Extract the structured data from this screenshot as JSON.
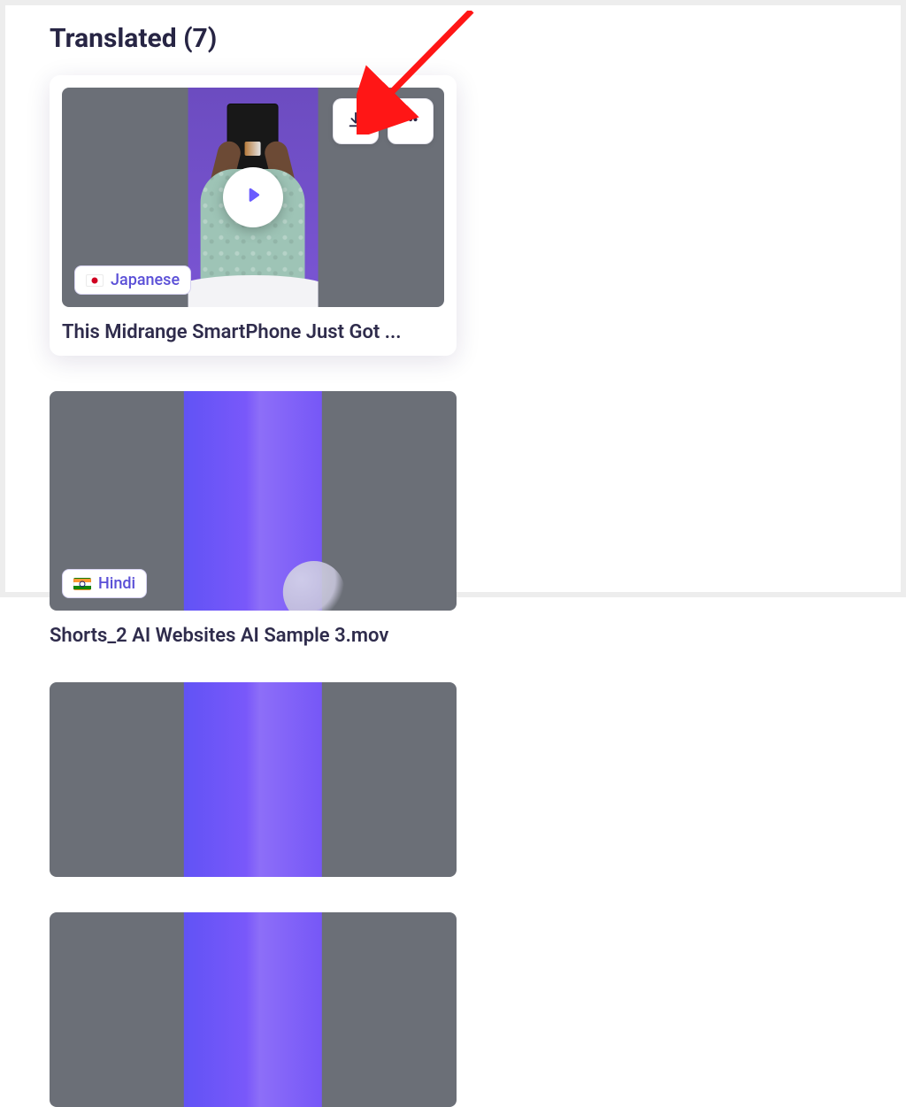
{
  "section": {
    "heading": "Translated (7)"
  },
  "cards": [
    {
      "title": "This Midrange SmartPhone Just Got ...",
      "language": "Japanese",
      "flag": "jp",
      "active": true,
      "thumbKind": "person"
    },
    {
      "title": "Shorts_2 AI Websites AI Sample 3.mov",
      "language": "Hindi",
      "flag": "in",
      "active": false,
      "thumbKind": "gradient"
    },
    {
      "thumbKind": "gradient"
    },
    {
      "thumbKind": "gradient"
    }
  ],
  "icons": {
    "download": "download-icon",
    "more": "more-icon",
    "play": "play-icon"
  }
}
